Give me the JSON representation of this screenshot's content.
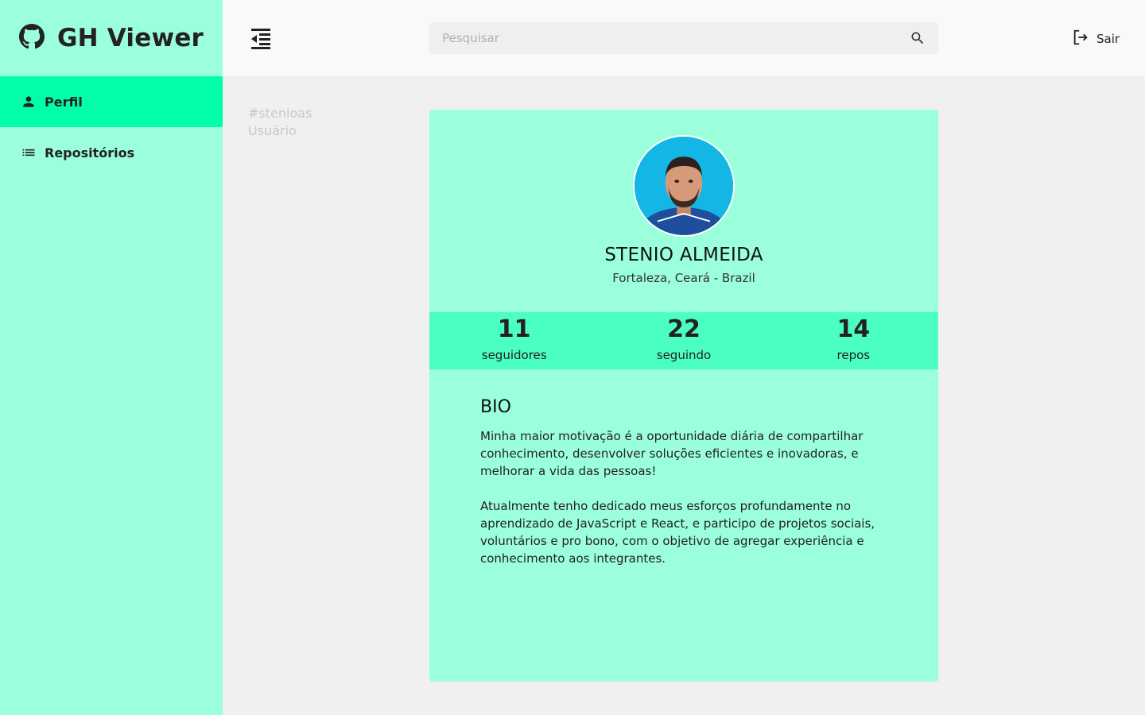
{
  "app": {
    "title": "GH Viewer",
    "logo_icon": "github-icon"
  },
  "sidebar": {
    "items": [
      {
        "label": "Perfil",
        "icon": "person-icon",
        "active": true
      },
      {
        "label": "Repositórios",
        "icon": "list-icon",
        "active": false
      }
    ]
  },
  "header": {
    "menu_icon": "menu-collapse-icon",
    "search": {
      "placeholder": "Pesquisar",
      "value": "",
      "icon": "search-icon"
    },
    "logout_label": "Sair",
    "logout_icon": "logout-icon"
  },
  "breadcrumb": {
    "handle": "#stenioas",
    "section": "Usuário"
  },
  "profile": {
    "name": "STENIO ALMEIDA",
    "location": "Fortaleza, Ceará - Brazil",
    "stats": [
      {
        "value": "11",
        "label": "seguidores"
      },
      {
        "value": "22",
        "label": "seguindo"
      },
      {
        "value": "14",
        "label": "repos"
      }
    ],
    "bio_title": "BIO",
    "bio_paragraphs": [
      "Minha maior motivação é a oportunidade diária de compartilhar conhecimento, desenvolver soluções eficientes e inovadoras, e melhorar a vida das pessoas!",
      "Atualmente tenho dedicado meus esforços profundamente no aprendizado de JavaScript e React, e participo de projetos sociais, voluntários e pro bono, com o objetivo de agregar experiência e conhecimento aos integrantes."
    ]
  },
  "colors": {
    "sidebar_bg": "#9bffdb",
    "active_item": "#00ffa8",
    "card_bg": "#9bffdb",
    "stats_bg": "#4bffc0",
    "page_bg": "#f0f0f0",
    "header_bg": "#f9f9f9"
  }
}
